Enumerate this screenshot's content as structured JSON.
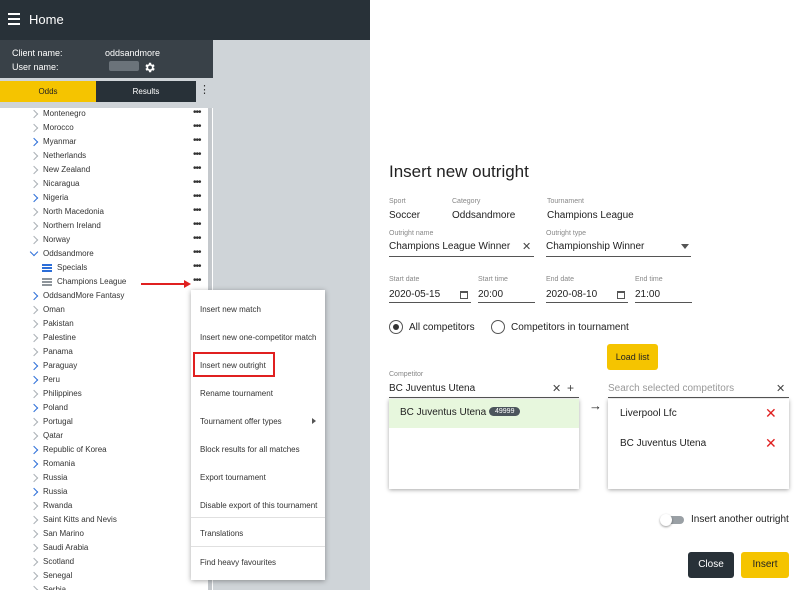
{
  "topbar": {
    "title": "Home"
  },
  "client": {
    "client_label": "Client name:",
    "client_value": "oddsandmore",
    "user_label": "User name:"
  },
  "tabs": {
    "odds": "Odds",
    "results": "Results",
    "more": "⋮"
  },
  "tree": {
    "items": [
      {
        "label": "Montenegro",
        "expandable": false
      },
      {
        "label": "Morocco",
        "expandable": false
      },
      {
        "label": "Myanmar",
        "expandable": true
      },
      {
        "label": "Netherlands",
        "expandable": false
      },
      {
        "label": "New Zealand",
        "expandable": false
      },
      {
        "label": "Nicaragua",
        "expandable": false
      },
      {
        "label": "Nigeria",
        "expandable": true
      },
      {
        "label": "North Macedonia",
        "expandable": false
      },
      {
        "label": "Northern Ireland",
        "expandable": false
      },
      {
        "label": "Norway",
        "expandable": false
      },
      {
        "label": "Oddsandmore",
        "expandable": true,
        "expanded": true
      },
      {
        "label": "Specials",
        "child": true
      },
      {
        "label": "Champions League",
        "child": true
      },
      {
        "label": "OddsandMore Fantasy",
        "expandable": true
      },
      {
        "label": "Oman",
        "expandable": false
      },
      {
        "label": "Pakistan",
        "expandable": false
      },
      {
        "label": "Palestine",
        "expandable": false
      },
      {
        "label": "Panama",
        "expandable": false
      },
      {
        "label": "Paraguay",
        "expandable": true
      },
      {
        "label": "Peru",
        "expandable": true
      },
      {
        "label": "Philippines",
        "expandable": false
      },
      {
        "label": "Poland",
        "expandable": true
      },
      {
        "label": "Portugal",
        "expandable": false
      },
      {
        "label": "Qatar",
        "expandable": false
      },
      {
        "label": "Republic of Korea",
        "expandable": true
      },
      {
        "label": "Romania",
        "expandable": true
      },
      {
        "label": "Russia",
        "expandable": false
      },
      {
        "label": "Russia",
        "expandable": true
      },
      {
        "label": "Rwanda",
        "expandable": false
      },
      {
        "label": "Saint Kitts and Nevis",
        "expandable": false
      },
      {
        "label": "San Marino",
        "expandable": false
      },
      {
        "label": "Saudi Arabia",
        "expandable": false
      },
      {
        "label": "Scotland",
        "expandable": false
      },
      {
        "label": "Senegal",
        "expandable": false
      },
      {
        "label": "Serbia",
        "expandable": false
      }
    ],
    "dots": "•••"
  },
  "context_menu": {
    "items": [
      "Insert new match",
      "Insert new one-competitor match",
      "Insert new outright",
      "Rename tournament",
      "Tournament offer types",
      "Block results for all matches",
      "Export tournament",
      "Disable export of this tournament",
      "Translations",
      "Find heavy favourites"
    ]
  },
  "dialog": {
    "title": "Insert new outright",
    "sport_label": "Sport",
    "sport_value": "Soccer",
    "category_label": "Category",
    "category_value": "Oddsandmore",
    "tournament_label": "Tournament",
    "tournament_value": "Champions League",
    "outright_name_label": "Outright name",
    "outright_name_value": "Champions League Winner",
    "outright_type_label": "Outright type",
    "outright_type_value": "Championship Winner",
    "start_date_label": "Start date",
    "start_date_value": "2020-05-15",
    "start_time_label": "Start time",
    "start_time_value": "20:00",
    "end_date_label": "End date",
    "end_date_value": "2020-08-10",
    "end_time_label": "End time",
    "end_time_value": "21:00",
    "radio_all": "All competitors",
    "radio_tournament": "Competitors in tournament",
    "load_list": "Load list",
    "competitor_label": "Competitor",
    "competitor_value": "BC Juventus Utena",
    "search_placeholder": "Search selected competitors",
    "result_name": "BC Juventus Utena",
    "result_id": "49999",
    "selected": [
      "Liverpool Lfc",
      "BC Juventus Utena"
    ],
    "insert_another": "Insert another outright",
    "close_btn": "Close",
    "insert_btn": "Insert"
  },
  "colors": {
    "accent": "#f5c400",
    "dark": "#283138",
    "danger": "#e02020",
    "link": "#2c6ed8"
  }
}
